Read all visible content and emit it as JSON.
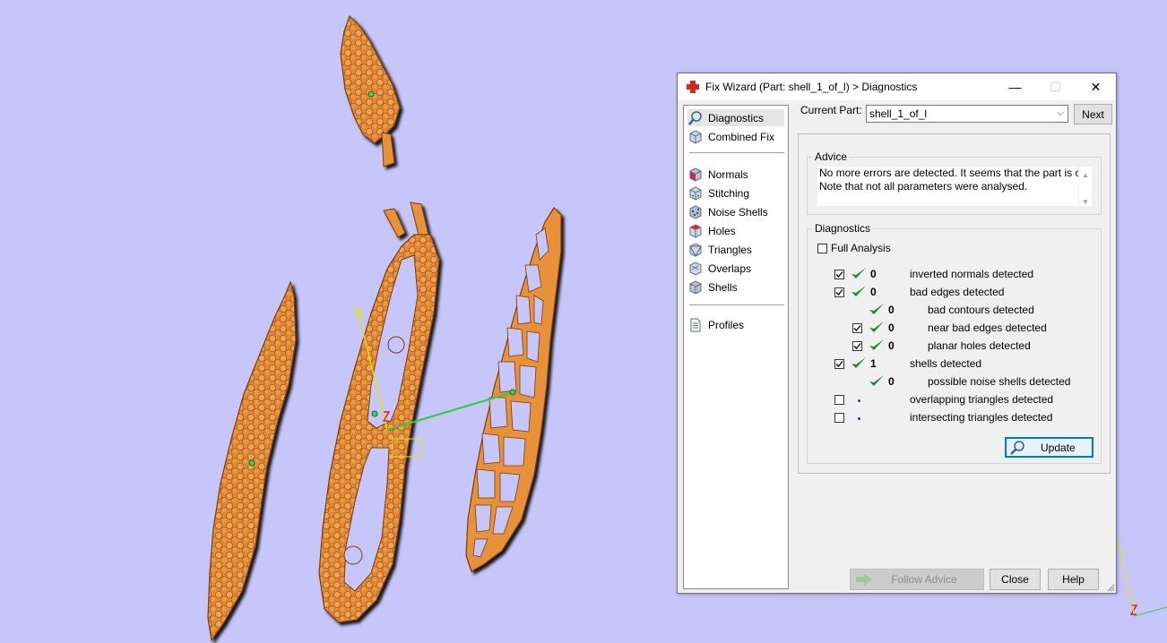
{
  "window": {
    "title": "Fix Wizard (Part: shell_1_of_l) > Diagnostics",
    "minimize_glyph": "—",
    "maximize_glyph": "☐",
    "close_glyph": "✕"
  },
  "nav": {
    "items": [
      {
        "label": "Diagnostics",
        "icon": "magnifier-icon",
        "selected": true
      },
      {
        "label": "Combined Fix",
        "icon": "cube-icon"
      },
      {
        "label": "Normals",
        "icon": "normals-cube-icon"
      },
      {
        "label": "Stitching",
        "icon": "stitching-cube-icon"
      },
      {
        "label": "Noise Shells",
        "icon": "noise-shells-icon"
      },
      {
        "label": "Holes",
        "icon": "holes-cube-icon"
      },
      {
        "label": "Triangles",
        "icon": "triangles-cube-icon"
      },
      {
        "label": "Overlaps",
        "icon": "overlaps-cube-icon"
      },
      {
        "label": "Shells",
        "icon": "shells-cube-icon"
      },
      {
        "label": "Profiles",
        "icon": "document-icon"
      }
    ]
  },
  "current_part": {
    "label": "Current Part:",
    "value": "shell_1_of_l",
    "next_label": "Next"
  },
  "advice": {
    "legend": "Advice",
    "line1": "No more errors are detected. It seems that the part is ok.",
    "line2": "Note that not all parameters were analysed."
  },
  "diagnostics": {
    "legend": "Diagnostics",
    "full_analysis_label": "Full Analysis",
    "full_analysis_checked": false,
    "rows": [
      {
        "label": "inverted normals detected",
        "count": "0",
        "checked": true,
        "status": "ok"
      },
      {
        "label": "bad edges detected",
        "count": "0",
        "checked": true,
        "status": "ok"
      },
      {
        "label": "bad contours detected",
        "count": "0",
        "status": "ok"
      },
      {
        "label": "near bad edges detected",
        "count": "0",
        "checked": true,
        "status": "ok"
      },
      {
        "label": "planar holes detected",
        "count": "0",
        "checked": true,
        "status": "ok"
      },
      {
        "label": "shells detected",
        "count": "1",
        "checked": true,
        "status": "ok"
      },
      {
        "label": "possible noise shells detected",
        "count": "0",
        "status": "ok"
      },
      {
        "label": "overlapping triangles detected",
        "checked": false,
        "status": "unknown"
      },
      {
        "label": "intersecting triangles detected",
        "checked": false,
        "status": "unknown"
      }
    ],
    "update_label": "Update"
  },
  "footer": {
    "follow_advice_label": "Follow Advice",
    "close_label": "Close",
    "help_label": "Help"
  },
  "viewport": {
    "background": "#c6c6fa",
    "part_color": "#e8913a",
    "part_dark": "#b5621b",
    "axis_y_color": "#e6e600",
    "axis_x_color": "#33cc33",
    "axis_z_color": "#e02020"
  },
  "colors": {
    "check_green": "#1e8a2e",
    "accent_red": "#d9261c"
  }
}
